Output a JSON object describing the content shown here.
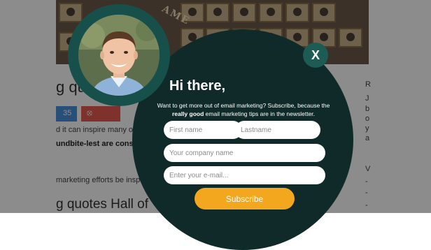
{
  "background": {
    "banner_text": "AME",
    "heading": "g quo",
    "share_count": "35",
    "share_icon": "stumbleupon-icon",
    "line1": "d it can inspire many o",
    "line2": "undbite-lest are consid",
    "line3": "marketing efforts be inspi",
    "heading2": "g quotes Hall of",
    "right_letters": [
      "R",
      "J",
      "b",
      "o",
      "y",
      "a",
      "V",
      "-",
      "-",
      "-"
    ]
  },
  "popup": {
    "close_label": "X",
    "title": "Hi there,",
    "desc_before": "Want to get more out of email marketing? Subscribe, because the",
    "desc_bold": "really good",
    "desc_after": "email marketing tips are in the newsletter.",
    "firstname_placeholder": "First name",
    "lastname_placeholder": "Lastname",
    "company_placeholder": "Your company name",
    "email_placeholder": "Enter your e-mail...",
    "subscribe_label": "Subscribe"
  },
  "colors": {
    "popup_bg": "#0f2a28",
    "accent": "#1d5c55",
    "button": "#f2a71e"
  }
}
